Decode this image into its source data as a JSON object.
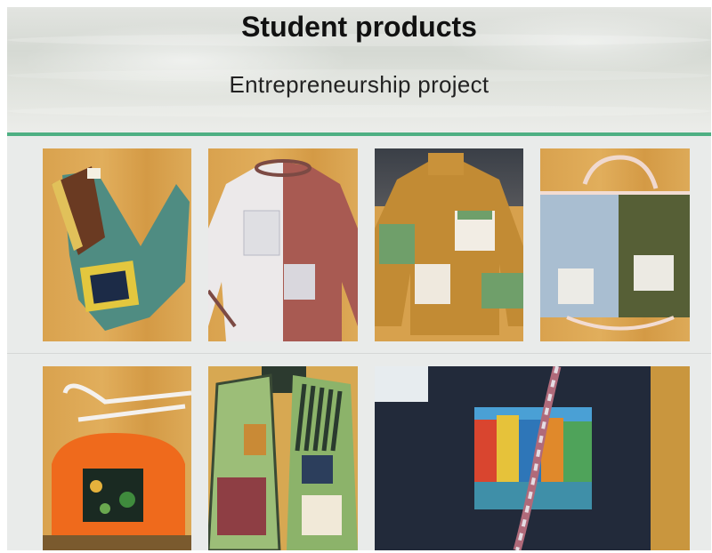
{
  "header": {
    "title": "Student products",
    "subtitle": "Entrepreneurship project"
  },
  "colors": {
    "accent_rule": "#4eb083",
    "page_background": "#e9ebea"
  },
  "gallery": {
    "row1": [
      "teal-crossbody-bag-photo",
      "white-rust-shirt-photo",
      "mustard-sweater-photo",
      "blue-olive-bag-photo"
    ],
    "row2": [
      "orange-tote-bag-photo",
      "green-vest-photo",
      "navy-tote-burano-photo"
    ]
  }
}
